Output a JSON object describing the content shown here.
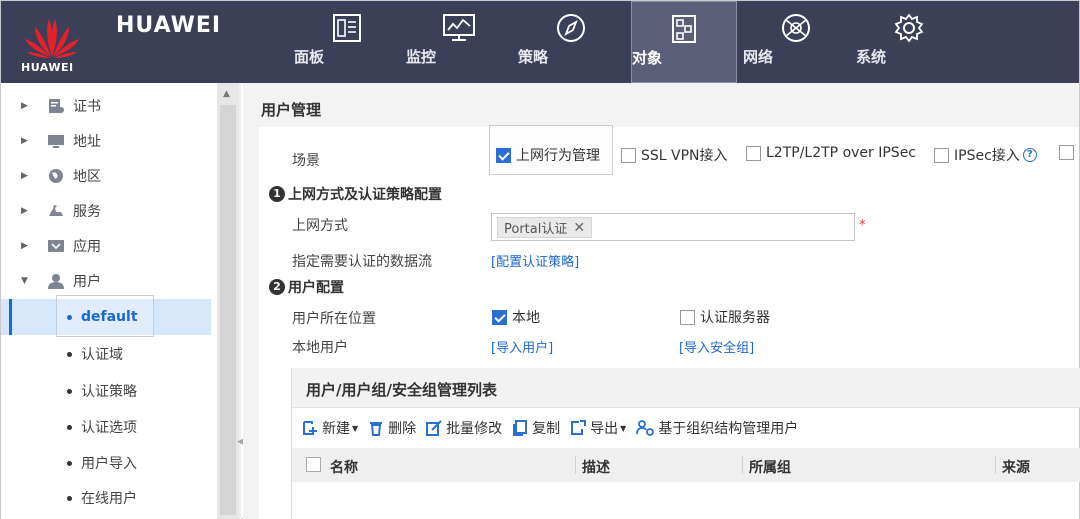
{
  "brand": {
    "name": "HUAWEI",
    "name_small": "HUAWEI"
  },
  "nav": {
    "tabs": [
      {
        "label": "面板",
        "icon": "dashboard-icon"
      },
      {
        "label": "监控",
        "icon": "monitor-icon"
      },
      {
        "label": "策略",
        "icon": "compass-icon"
      },
      {
        "label": "对象",
        "icon": "object-icon",
        "active": true
      },
      {
        "label": "网络",
        "icon": "globe-icon"
      },
      {
        "label": "系统",
        "icon": "gear-icon"
      }
    ]
  },
  "sidebar": {
    "items": [
      {
        "label": "证书",
        "icon": "certificate-icon"
      },
      {
        "label": "地址",
        "icon": "monitor-address-icon"
      },
      {
        "label": "地区",
        "icon": "region-globe-icon"
      },
      {
        "label": "服务",
        "icon": "service-icon"
      },
      {
        "label": "应用",
        "icon": "application-icon"
      },
      {
        "label": "用户",
        "icon": "user-icon",
        "expanded": true
      }
    ],
    "sub_items": [
      {
        "label": "default",
        "active": true
      },
      {
        "label": "认证域"
      },
      {
        "label": "认证策略"
      },
      {
        "label": "认证选项"
      },
      {
        "label": "用户导入"
      },
      {
        "label": "在线用户"
      }
    ]
  },
  "main": {
    "title": "用户管理",
    "scene_label": "场景",
    "scene_options": [
      {
        "label": "上网行为管理",
        "checked": true
      },
      {
        "label": "SSL VPN接入",
        "checked": false
      },
      {
        "label": "L2TP/L2TP over IPSec",
        "checked": false
      },
      {
        "label": "IPSec接入",
        "checked": false
      }
    ],
    "section1": {
      "num": "1",
      "title": "上网方式及认证策略配置"
    },
    "access_mode_label": "上网方式",
    "access_mode_tag": "Portal认证",
    "required_mark": "*",
    "flow_label": "指定需要认证的数据流",
    "flow_link": "[配置认证策略]",
    "section2": {
      "num": "2",
      "title": "用户配置"
    },
    "location_label": "用户所在位置",
    "location_local": "本地",
    "location_server": "认证服务器",
    "local_user_label": "本地用户",
    "import_user_link": "[导入用户]",
    "import_secgroup_link": "[导入安全组]"
  },
  "list": {
    "title": "用户/用户组/安全组管理列表",
    "toolbar": {
      "new": "新建",
      "delete": "删除",
      "batch_edit": "批量修改",
      "copy": "复制",
      "export": "导出",
      "org_manage": "基于组织结构管理用户"
    },
    "columns": [
      "名称",
      "描述",
      "所属组",
      "来源"
    ]
  },
  "colors": {
    "topbar": "#3b3f58",
    "accent": "#1d68c8",
    "active_row": "#d7e7fb"
  }
}
